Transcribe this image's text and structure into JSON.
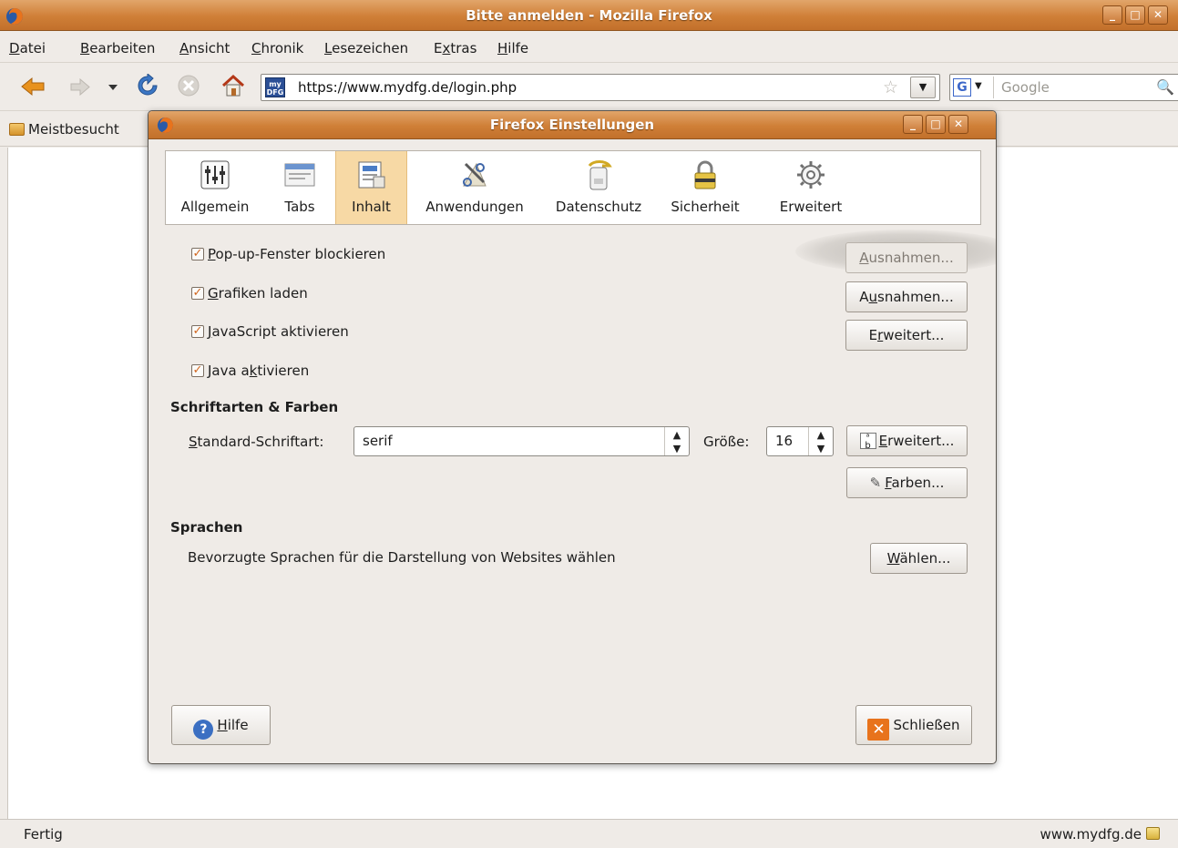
{
  "window": {
    "title": "Bitte anmelden - Mozilla Firefox"
  },
  "menu": [
    "Datei",
    "Bearbeiten",
    "Ansicht",
    "Chronik",
    "Lesezeichen",
    "Extras",
    "Hilfe"
  ],
  "navbar": {
    "url": "https://www.mydfg.de/login.php",
    "site_icon_text": "my DFG",
    "search_placeholder": "Google",
    "search_engine_letter": "G"
  },
  "bookmarks": {
    "first": "Meistbesucht"
  },
  "status": {
    "text": "Fertig",
    "host": "www.mydfg.de"
  },
  "dialog": {
    "title": "Firefox Einstellungen",
    "panes": [
      "Allgemein",
      "Tabs",
      "Inhalt",
      "Anwendungen",
      "Datenschutz",
      "Sicherheit",
      "Erweitert"
    ],
    "active_pane": "Inhalt",
    "options": [
      {
        "label": "Pop-up-Fenster blockieren",
        "checked": true
      },
      {
        "label": "Grafiken laden",
        "checked": true
      },
      {
        "label": "JavaScript aktivieren",
        "checked": true
      },
      {
        "label": "Java aktivieren",
        "checked": true
      }
    ],
    "buttons": {
      "exceptions_popup": "Ausnahmen...",
      "exceptions_images": "Ausnahmen...",
      "advanced_js": "Erweitert...",
      "advanced_fonts": "Erweitert...",
      "colors": "Farben...",
      "choose_languages": "Wählen...",
      "help": "Hilfe",
      "close": "Schließen"
    },
    "fonts": {
      "heading": "Schriftarten & Farben",
      "default_font_label": "Standard-Schriftart:",
      "default_font_value": "serif",
      "size_label": "Größe:",
      "size_value": "16"
    },
    "languages": {
      "heading": "Sprachen",
      "description": "Bevorzugte Sprachen für die Darstellung von Websites wählen"
    }
  }
}
